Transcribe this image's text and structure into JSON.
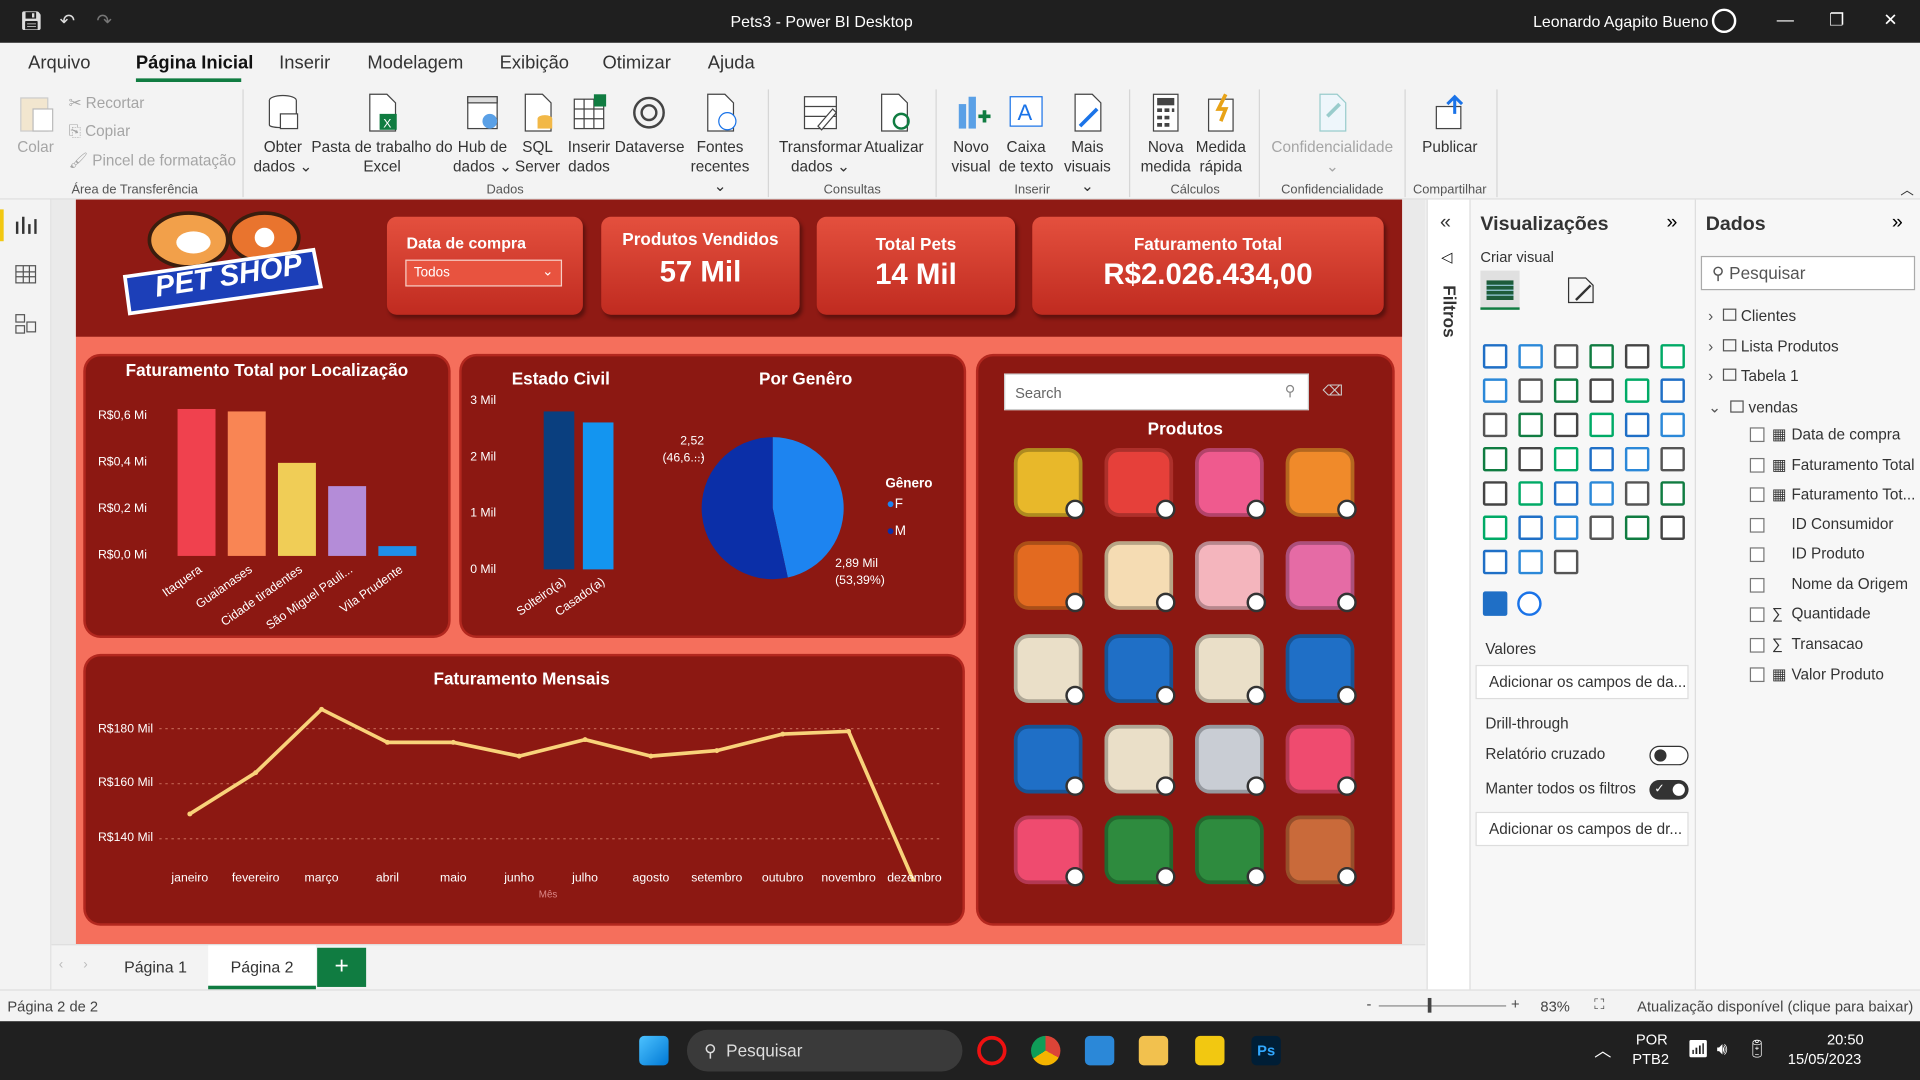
{
  "window": {
    "title": "Pets3 - Power BI Desktop",
    "user": "Leonardo Agapito Bueno"
  },
  "menu": [
    "Arquivo",
    "Página Inicial",
    "Inserir",
    "Modelagem",
    "Exibição",
    "Otimizar",
    "Ajuda"
  ],
  "ribbon": {
    "colar": "Colar",
    "recortar": "Recortar",
    "copiar": "Copiar",
    "pincel": "Pincel de formatação",
    "obter": "Obter dados",
    "excel": "Pasta de trabalho do Excel",
    "hub": "Hub de dados",
    "sql": "SQL Server",
    "inserir_dados": "Inserir dados",
    "dataverse": "Dataverse",
    "fontes": "Fontes recentes",
    "transformar": "Transformar dados",
    "atualizar": "Atualizar",
    "novo_visual": "Novo visual",
    "caixa_texto": "Caixa de texto",
    "mais_visuais": "Mais visuais",
    "nova_medida": "Nova medida",
    "medida_rapida": "Medida rápida",
    "confidencialidade": "Confidencialidade",
    "publicar": "Publicar",
    "groups": {
      "area": "Área de Transferência",
      "dados": "Dados",
      "consultas": "Consultas",
      "inserir": "Inserir",
      "calculos": "Cálculos",
      "conf": "Confidencialidade",
      "compartilhar": "Compartilhar"
    }
  },
  "report": {
    "logo_text": "PET SHOP",
    "slicer": {
      "title": "Data de compra",
      "value": "Todos"
    },
    "cards": [
      {
        "title": "Produtos Vendidos",
        "value": "57 Mil"
      },
      {
        "title": "Total Pets",
        "value": "14 Mil"
      },
      {
        "title": "Faturamento Total",
        "value": "R$2.026.434,00"
      }
    ],
    "search_placeholder": "Search",
    "produtos_title": "Produtos",
    "marital_title": "Estado Civil",
    "gender_title": "Por Genêro",
    "gender_legend_title": "Gênero",
    "gender_labels": {
      "f": "2,52 ...",
      "f_pct": "(46,6...)",
      "m": "2,89 Mil",
      "m_pct": "(53,39%)"
    },
    "product_icons": [
      "sun-ball",
      "collar-red",
      "collar-pink",
      "dog-toy",
      "collar-orange",
      "bone",
      "treat-bag",
      "food-can",
      "food-bag-beige",
      "food-bag-blue",
      "food-bag-beige",
      "food-bag-blue",
      "food-bag-blue",
      "food-bag-beige",
      "mouse-toy",
      "pink-jacket",
      "pink-jacket",
      "green-jacket",
      "green-jacket",
      "cat-wand"
    ]
  },
  "chart_data": [
    {
      "type": "bar",
      "title": "Faturamento Total por Localização",
      "categories": [
        "Itaquera",
        "Guaianases",
        "Cidade tiradentes",
        "São Miguel Pauli...",
        "Vila Prudente"
      ],
      "values": [
        0.63,
        0.62,
        0.4,
        0.3,
        0.04
      ],
      "ytick_labels": [
        "R$0,6 Mi",
        "R$0,4 Mi",
        "R$0,2 Mi",
        "R$0,0 Mi"
      ],
      "ylim": [
        0,
        0.7
      ],
      "colors": [
        "#f0414e",
        "#f98554",
        "#f0cd56",
        "#b48cd8",
        "#1f8fe8"
      ]
    },
    {
      "type": "bar",
      "title": "Estado Civil",
      "categories": [
        "Solteiro(a)",
        "Casado(a)"
      ],
      "values": [
        2.8,
        2.6
      ],
      "ytick_labels": [
        "3 Mil",
        "2 Mil",
        "1 Mil",
        "0 Mil"
      ],
      "ylim": [
        0,
        3
      ],
      "colors": [
        "#0a3f7f",
        "#1395f0"
      ]
    },
    {
      "type": "pie",
      "title": "Por Genêro",
      "legend_title": "Gênero",
      "categories": [
        "F",
        "M"
      ],
      "values": [
        2.52,
        2.89
      ],
      "colors": [
        "#1d84f0",
        "#0b2fa8"
      ]
    },
    {
      "type": "line",
      "title": "Faturamento Mensais",
      "xlabel": "Mês",
      "categories": [
        "janeiro",
        "fevereiro",
        "março",
        "abril",
        "maio",
        "junho",
        "julho",
        "agosto",
        "setembro",
        "outubro",
        "novembro",
        "dezembro"
      ],
      "values": [
        149,
        164,
        187,
        175,
        175,
        170,
        176,
        170,
        172,
        178,
        179,
        124
      ],
      "ytick_labels": [
        "R$180 Mil",
        "R$160 Mil",
        "R$140 Mil"
      ],
      "ylim": [
        120,
        190
      ],
      "color": "#f9d27a"
    }
  ],
  "tabs": [
    "Página 1",
    "Página 2"
  ],
  "status": {
    "page": "Página 2 de 2",
    "zoom": "83%",
    "update": "Atualização disponível (clique para baixar)"
  },
  "filters_label": "Filtros",
  "vis": {
    "title": "Visualizações",
    "create": "Criar visual",
    "valores": "Valores",
    "valores_ph": "Adicionar os campos de da...",
    "drill": "Drill-through",
    "cruzado": "Relatório cruzado",
    "manter": "Manter todos os filtros",
    "drill_ph": "Adicionar os campos de dr..."
  },
  "data_pane": {
    "title": "Dados",
    "search": "Pesquisar",
    "tables": [
      "Clientes",
      "Lista Produtos",
      "Tabela 1",
      "vendas"
    ],
    "fields": [
      "Data de compra",
      "Faturamento Total",
      "Faturamento Tot...",
      "ID Consumidor",
      "ID Produto",
      "Nome da Origem",
      "Quantidade",
      "Transacao",
      "Valor Produto"
    ]
  },
  "taskbar": {
    "search": "Pesquisar",
    "lang1": "POR",
    "lang2": "PTB2",
    "time": "20:50",
    "date": "15/05/2023"
  }
}
